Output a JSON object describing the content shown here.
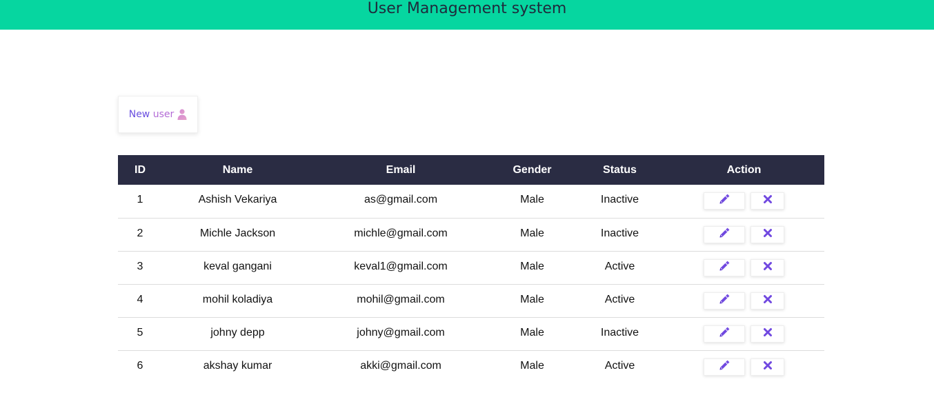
{
  "header": {
    "title": "User Management system"
  },
  "toolbar": {
    "new_user_label_part1": "New ",
    "new_user_label_part2": "user"
  },
  "table": {
    "columns": [
      "ID",
      "Name",
      "Email",
      "Gender",
      "Status",
      "Action"
    ],
    "rows": [
      {
        "id": "1",
        "name": "Ashish Vekariya",
        "email": "as@gmail.com",
        "gender": "Male",
        "status": "Inactive"
      },
      {
        "id": "2",
        "name": "Michle Jackson",
        "email": "michle@gmail.com",
        "gender": "Male",
        "status": "Inactive"
      },
      {
        "id": "3",
        "name": "keval gangani",
        "email": "keval1@gmail.com",
        "gender": "Male",
        "status": "Active"
      },
      {
        "id": "4",
        "name": "mohil koladiya",
        "email": "mohil@gmail.com",
        "gender": "Male",
        "status": "Active"
      },
      {
        "id": "5",
        "name": "johny depp",
        "email": "johny@gmail.com",
        "gender": "Male",
        "status": "Inactive"
      },
      {
        "id": "6",
        "name": "akshay kumar",
        "email": "akki@gmail.com",
        "gender": "Male",
        "status": "Active"
      }
    ]
  },
  "icons": {
    "new_user": "user-icon",
    "edit": "pencil-icon",
    "delete": "close-icon"
  },
  "colors": {
    "header_bg": "#06d6a0",
    "table_header_bg": "#2a2c43",
    "accent": "#6a4fe0"
  }
}
